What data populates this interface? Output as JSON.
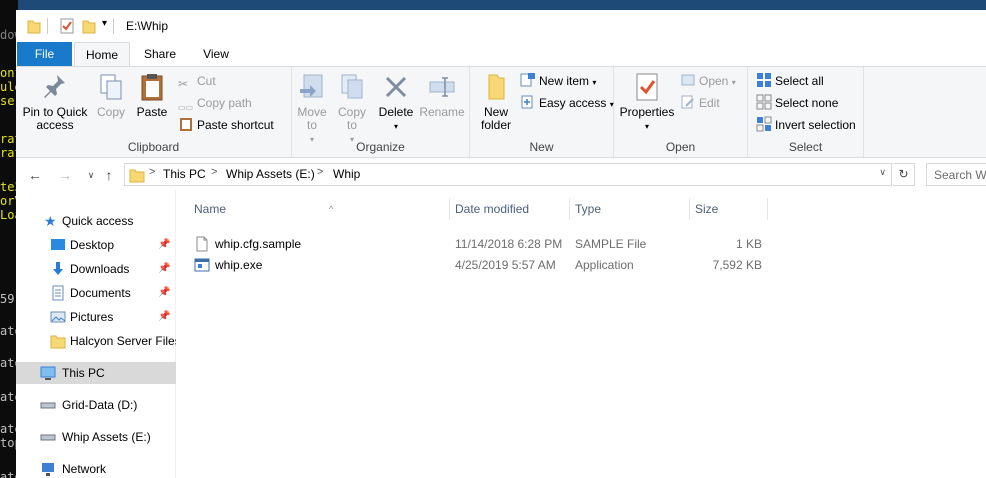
{
  "window": {
    "title": "E:\\Whip",
    "qat_dropdown": "▾"
  },
  "console_lines": [
    {
      "text": "dow",
      "color": "#808080"
    },
    {
      "text": "onf",
      "color": "#e5e510"
    },
    {
      "text": "ule",
      "color": "#e5e510"
    },
    {
      "text": "ser",
      "color": "#e5e510"
    },
    {
      "text": "rat",
      "color": "#e5e510"
    },
    {
      "text": "rat",
      "color": "#e5e510"
    },
    {
      "text": "te3",
      "color": "#e5e510"
    },
    {
      "text": "orV",
      "color": "#e5e510"
    },
    {
      "text": "Loa",
      "color": "#e5e510"
    },
    {
      "text": "59",
      "color": "#c0c0c0"
    },
    {
      "text": "ato",
      "color": "#c0c0c0"
    },
    {
      "text": "ato",
      "color": "#c0c0c0"
    },
    {
      "text": "ato",
      "color": "#c0c0c0"
    },
    {
      "text": "ato",
      "color": "#c0c0c0"
    },
    {
      "text": "top",
      "color": "#c0c0c0"
    },
    {
      "text": "ato",
      "color": "#c0c0c0"
    }
  ],
  "tabs": {
    "file": "File",
    "home": "Home",
    "share": "Share",
    "view": "View"
  },
  "ribbon": {
    "clipboard": {
      "label": "Clipboard",
      "pin": "Pin to Quick access",
      "copy": "Copy",
      "paste": "Paste",
      "cut": "Cut",
      "copy_path": "Copy path",
      "paste_shortcut": "Paste shortcut"
    },
    "organize": {
      "label": "Organize",
      "move_to": "Move to",
      "copy_to": "Copy to",
      "delete": "Delete",
      "rename": "Rename"
    },
    "new": {
      "label": "New",
      "new_folder": "New folder",
      "new_item": "New item",
      "easy_access": "Easy access"
    },
    "open": {
      "label": "Open",
      "properties": "Properties",
      "open": "Open",
      "edit": "Edit"
    },
    "select": {
      "label": "Select",
      "select_all": "Select all",
      "select_none": "Select none",
      "invert": "Invert selection"
    }
  },
  "address": {
    "segments": [
      "This PC",
      "Whip Assets (E:)",
      "Whip"
    ],
    "search_placeholder": "Search Whip"
  },
  "nav": {
    "quick_access": "Quick access",
    "desktop": "Desktop",
    "downloads": "Downloads",
    "documents": "Documents",
    "pictures": "Pictures",
    "halcyon": "Halcyon Server Files",
    "this_pc": "This PC",
    "grid_data": "Grid-Data (D:)",
    "whip_assets": "Whip Assets (E:)",
    "network": "Network"
  },
  "columns": {
    "name": "Name",
    "date": "Date modified",
    "type": "Type",
    "size": "Size"
  },
  "files": [
    {
      "name": "whip.cfg.sample",
      "date": "11/14/2018 6:28 PM",
      "type": "SAMPLE File",
      "size": "1 KB",
      "icon": "generic-file-icon"
    },
    {
      "name": "whip.exe",
      "date": "4/25/2019 5:57 AM",
      "type": "Application",
      "size": "7,592 KB",
      "icon": "application-icon"
    }
  ]
}
